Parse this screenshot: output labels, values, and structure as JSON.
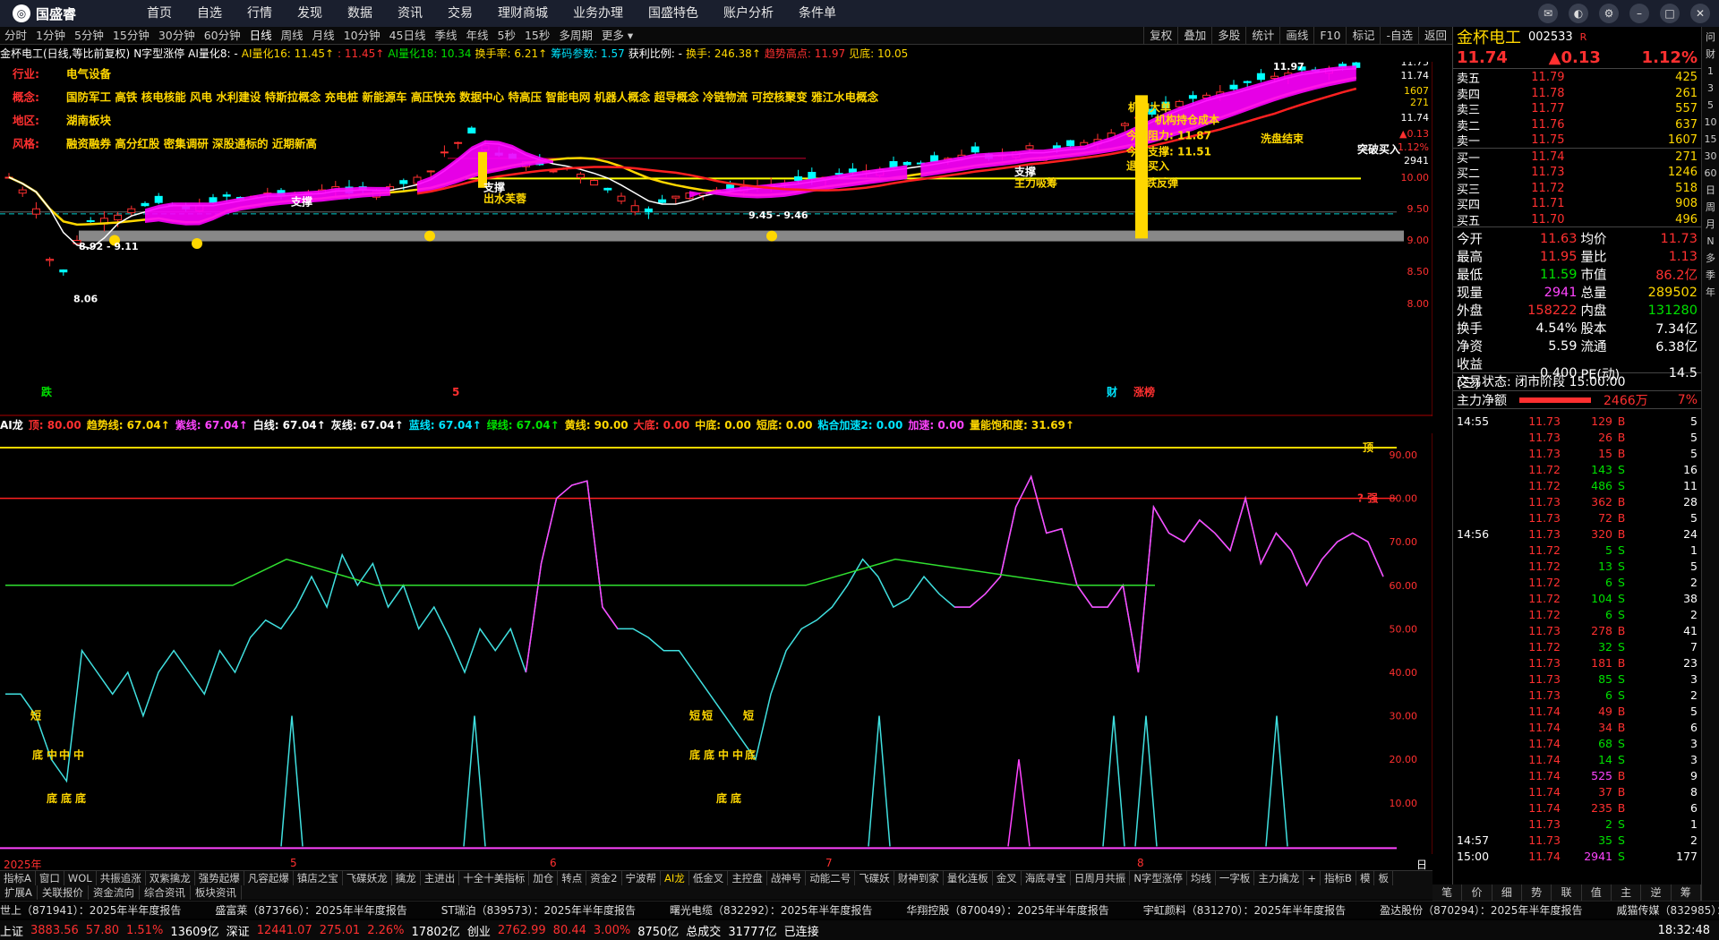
{
  "topbar": {
    "brand": "国盛睿",
    "menu": [
      "首页",
      "自选",
      "行情",
      "发现",
      "数据",
      "资讯",
      "交易",
      "理财商城",
      "业务办理",
      "国盛特色",
      "账户分析",
      "条件单"
    ]
  },
  "periods": [
    "分时",
    "1分钟",
    "5分钟",
    "15分钟",
    "30分钟",
    "60分钟",
    "日线",
    "周线",
    "月线",
    "10分钟",
    "45日线",
    "季线",
    "年线",
    "5秒",
    "15秒",
    "多周期",
    "更多 ▾"
  ],
  "period_right": [
    "复权",
    "叠加",
    "多股",
    "统计",
    "画线",
    "F10",
    "标记",
    "-自选",
    "返回"
  ],
  "kinfo": [
    {
      "t": "金杯电工(日线,等比前复权)",
      "c": "wht"
    },
    {
      "t": "N字型涨停",
      "c": "wht"
    },
    {
      "t": "AI量化8: -",
      "c": "wht"
    },
    {
      "t": "AI量化16: 11.45↑",
      "c": "yel"
    },
    {
      "t": ": 11.45↑",
      "c": "red"
    },
    {
      "t": "AI量化18: 10.34",
      "c": "green"
    },
    {
      "t": "换手率: 6.21↑",
      "c": "yel"
    },
    {
      "t": "筹码参数: 1.57",
      "c": "cy"
    },
    {
      "t": "获利比例: -",
      "c": "wht"
    },
    {
      "t": "换手: 246.38↑",
      "c": "yel"
    },
    {
      "t": "趋势高点: 11.97",
      "c": "red"
    },
    {
      "t": "见底: 10.05",
      "c": "yel"
    }
  ],
  "info": [
    {
      "k": "行业:",
      "v": "电气设备"
    },
    {
      "k": "概念:",
      "v": "国防军工 高铁 核电核能 风电 水利建设 特斯拉概念 充电桩 新能源车 高压快充 数据中心 特高压 智能电网 机器人概念 超导概念 冷链物流 可控核聚变 雅江水电概念"
    },
    {
      "k": "地区:",
      "v": "湖南板块"
    },
    {
      "k": "风格:",
      "v": "融资融券 高分红股 密集调研 深股通标的 近期新高"
    }
  ],
  "main_labels": {
    "support1": "支撑",
    "support2": "支撑",
    "support3": "支撑",
    "out": "出水芙蓉",
    "low1": "8.92 - 9.11",
    "low2": "9.45 - 9.46",
    "min": "8.06",
    "hi": "11.97",
    "main_force": "主力吸筹",
    "wash": "洗盘结束",
    "breakout": "突破买入",
    "rebound": "超跌反弹",
    "inst": "机构大单",
    "cost": "机构持仓成本",
    "today_res": "今日阻力: 11.87",
    "today_sup": "今日支撑: 11.51",
    "exit": "退出买入",
    "fin": "财",
    "dn": "跌",
    "lim": "涨榜",
    "five": "5"
  },
  "price_axis": [
    "11.75",
    "11.74",
    "1607",
    "271",
    "11.74",
    "▲0.13",
    "1.12%",
    "2941",
    "10.00",
    "9.50",
    "9.00",
    "8.50",
    "8.00"
  ],
  "sub_header": [
    {
      "t": "AI龙",
      "c": "wht"
    },
    {
      "t": "顶: 80.00",
      "c": "red"
    },
    {
      "t": "趋势线: 67.04↑",
      "c": "yel"
    },
    {
      "t": "紫线: 67.04↑",
      "c": "mag"
    },
    {
      "t": "白线: 67.04↑",
      "c": "wht"
    },
    {
      "t": "灰线: 67.04↑",
      "c": "wht"
    },
    {
      "t": "蓝线: 67.04↑",
      "c": "cy"
    },
    {
      "t": "绿线: 67.04↑",
      "c": "green"
    },
    {
      "t": "黄线: 90.00",
      "c": "yel"
    },
    {
      "t": "大底: 0.00",
      "c": "red"
    },
    {
      "t": "中底: 0.00",
      "c": "yel"
    },
    {
      "t": "短底: 0.00",
      "c": "yel"
    },
    {
      "t": "粘合加速2: 0.00",
      "c": "cy"
    },
    {
      "t": "加速: 0.00",
      "c": "mag"
    },
    {
      "t": "量能饱和度: 31.69↑",
      "c": "yel"
    }
  ],
  "sub_axis": [
    "90.00",
    "80.00",
    "70.00",
    "60.00",
    "50.00",
    "40.00",
    "30.00",
    "20.00",
    "10.00"
  ],
  "sub_labels": {
    "top": "顶",
    "strong": "? 强",
    "short": "短",
    "mid": "中",
    "bottom": "底"
  },
  "dates": [
    "2025年",
    "5",
    "6",
    "7",
    "8"
  ],
  "date_right": "日线",
  "ind_tabs": [
    "指标A",
    "窗口",
    "WOL",
    "共振追涨",
    "双紫擒龙",
    "强势起爆",
    "凡容起爆",
    "镇店之宝",
    "飞碟妖龙",
    "擒龙",
    "主进出",
    "十全十美指标",
    "加仓",
    "转点",
    "资金2",
    "宁波帮",
    "AI龙",
    "低金叉",
    "主控盘",
    "战神号",
    "动能二号",
    "飞碟妖",
    "财神到家",
    "量化连板",
    "金叉",
    "海底寻宝",
    "日周月共振",
    "N字型涨停",
    "均线",
    "一字板",
    "主力擒龙",
    "+",
    "指标B",
    "模",
    "板"
  ],
  "bot_tabs": [
    "扩展A",
    "关联报价",
    "资金流向",
    "综合资讯",
    "板块资讯"
  ],
  "ticker": [
    "世上（871941）：2025年半年度报告",
    "盛富莱（873766）：2025年半年度报告",
    "ST瑞泊（839573）：2025年半年度报告",
    "曙光电缆（832292）：2025年半年度报告",
    "华翔控股（870049）：2025年半年度报告",
    "宇虹颜料（831270）：2025年半年度报告",
    "盈达股份（870294）：2025年半年度报告",
    "威猫传媒（832985）：2025年"
  ],
  "status": [
    {
      "t": "上证",
      "c": "wht"
    },
    {
      "t": "3883.56",
      "c": "red"
    },
    {
      "t": "57.80",
      "c": "red"
    },
    {
      "t": "1.51%",
      "c": "red"
    },
    {
      "t": "13609亿",
      "c": "wht"
    },
    {
      "t": "深证",
      "c": "wht"
    },
    {
      "t": "12441.07",
      "c": "red"
    },
    {
      "t": "275.01",
      "c": "red"
    },
    {
      "t": "2.26%",
      "c": "red"
    },
    {
      "t": "17802亿",
      "c": "wht"
    },
    {
      "t": "创业",
      "c": "wht"
    },
    {
      "t": "2762.99",
      "c": "red"
    },
    {
      "t": "80.44",
      "c": "red"
    },
    {
      "t": "3.00%",
      "c": "red"
    },
    {
      "t": "8750亿",
      "c": "wht"
    },
    {
      "t": "总成交",
      "c": "wht"
    },
    {
      "t": "31777亿",
      "c": "wht"
    },
    {
      "t": "已连接",
      "c": "wht"
    }
  ],
  "clock": "18:32:48",
  "quote": {
    "name": "金杯电工",
    "code": "002533",
    "tag": "R",
    "price": "11.74",
    "chg": "▲0.13",
    "pct": "1.12%"
  },
  "asks": [
    [
      "卖五",
      "11.79",
      "425"
    ],
    [
      "卖四",
      "11.78",
      "261"
    ],
    [
      "卖三",
      "11.77",
      "557"
    ],
    [
      "卖二",
      "11.76",
      "637"
    ],
    [
      "卖一",
      "11.75",
      "1607"
    ]
  ],
  "bids": [
    [
      "买一",
      "11.74",
      "271"
    ],
    [
      "买二",
      "11.73",
      "1246"
    ],
    [
      "买三",
      "11.72",
      "518"
    ],
    [
      "买四",
      "11.71",
      "908"
    ],
    [
      "买五",
      "11.70",
      "496"
    ]
  ],
  "stats": [
    [
      "今开",
      "11.63",
      "均价",
      "11.73"
    ],
    [
      "最高",
      "11.95",
      "量比",
      "1.13"
    ],
    [
      "最低",
      "11.59",
      "市值",
      "86.2亿"
    ],
    [
      "现量",
      "2941",
      "总量",
      "289502"
    ],
    [
      "外盘",
      "158222",
      "内盘",
      "131280"
    ],
    [
      "换手",
      "4.54%",
      "股本",
      "7.34亿"
    ],
    [
      "净资",
      "5.59",
      "流通",
      "6.38亿"
    ],
    [
      "收益(三)",
      "0.400",
      "PE(动)",
      "14.5"
    ]
  ],
  "trade_state": "交易状态: 闭市阶段 15:00:00",
  "net_flow": {
    "label": "主力净额",
    "value": "2466万",
    "pct": "7%"
  },
  "ticks": [
    [
      "14:55",
      "11.73",
      "129",
      "B",
      "5"
    ],
    [
      "",
      "11.73",
      "26",
      "B",
      "5"
    ],
    [
      "",
      "11.73",
      "15",
      "B",
      "5"
    ],
    [
      "",
      "11.72",
      "143",
      "S",
      "16"
    ],
    [
      "",
      "11.72",
      "486",
      "S",
      "11"
    ],
    [
      "",
      "11.73",
      "362",
      "B",
      "28"
    ],
    [
      "",
      "11.73",
      "72",
      "B",
      "5"
    ],
    [
      "14:56",
      "11.73",
      "320",
      "B",
      "24"
    ],
    [
      "",
      "11.72",
      "5",
      "S",
      "1"
    ],
    [
      "",
      "11.72",
      "13",
      "S",
      "5"
    ],
    [
      "",
      "11.72",
      "6",
      "S",
      "2"
    ],
    [
      "",
      "11.72",
      "104",
      "S",
      "38"
    ],
    [
      "",
      "11.72",
      "6",
      "S",
      "2"
    ],
    [
      "",
      "11.73",
      "278",
      "B",
      "41"
    ],
    [
      "",
      "11.72",
      "32",
      "S",
      "7"
    ],
    [
      "",
      "11.73",
      "181",
      "B",
      "23"
    ],
    [
      "",
      "11.73",
      "85",
      "S",
      "3"
    ],
    [
      "",
      "11.73",
      "6",
      "S",
      "2"
    ],
    [
      "",
      "11.74",
      "49",
      "B",
      "5"
    ],
    [
      "",
      "11.74",
      "34",
      "B",
      "6"
    ],
    [
      "",
      "11.74",
      "68",
      "S",
      "3"
    ],
    [
      "",
      "11.74",
      "14",
      "S",
      "3"
    ],
    [
      "",
      "11.74",
      "525",
      "B",
      "9"
    ],
    [
      "",
      "11.74",
      "37",
      "B",
      "8"
    ],
    [
      "",
      "11.74",
      "235",
      "B",
      "6"
    ],
    [
      "",
      "11.73",
      "2",
      "S",
      "1"
    ],
    [
      "14:57",
      "11.73",
      "35",
      "S",
      "2"
    ],
    [
      "15:00",
      "11.74",
      "2941",
      "S",
      "177"
    ]
  ],
  "rp_tabs": [
    "笔",
    "价",
    "细",
    "势",
    "联",
    "值",
    "主",
    "逆",
    "筹"
  ],
  "side": [
    "问",
    "财",
    "1",
    "3",
    "5",
    "10",
    "15",
    "30",
    "60",
    "日",
    "周",
    "月",
    "N",
    "多",
    "季",
    "年"
  ]
}
